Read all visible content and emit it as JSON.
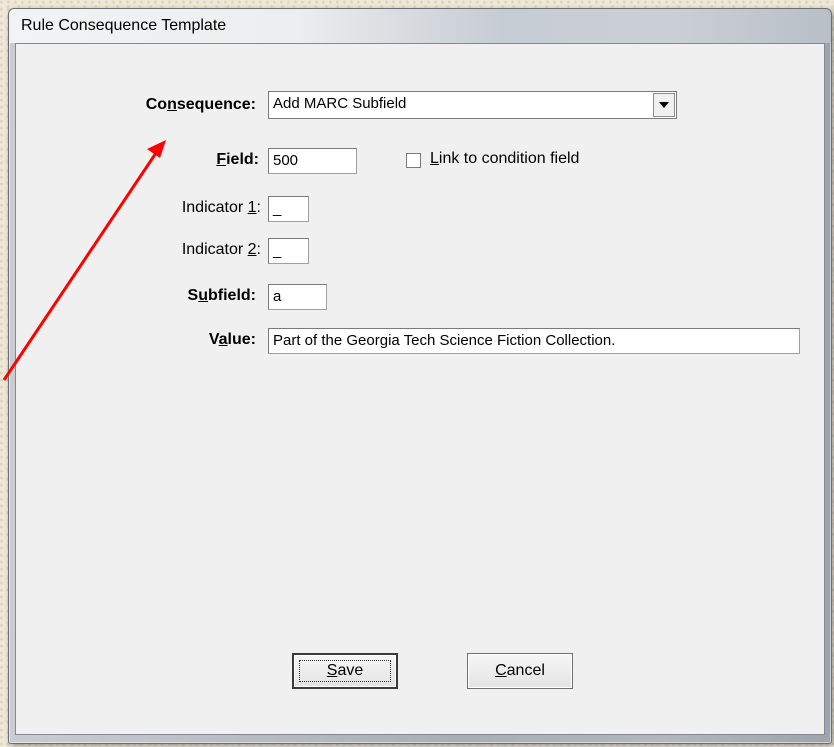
{
  "window": {
    "title": "Rule Consequence Template"
  },
  "form": {
    "consequence": {
      "label_pre": "Co",
      "label_key": "n",
      "label_post": "sequence:",
      "value": "Add MARC Subfield"
    },
    "field": {
      "label_key": "F",
      "label_post": "ield:",
      "value": "500"
    },
    "link_checkbox": {
      "label_key": "L",
      "label_post": "ink to condition field",
      "checked": false
    },
    "indicator1": {
      "label_pre": "Indicator ",
      "label_key": "1",
      "label_post": ":",
      "value": "_"
    },
    "indicator2": {
      "label_pre": "Indicator ",
      "label_key": "2",
      "label_post": ":",
      "value": "_"
    },
    "subfield": {
      "label_pre": "S",
      "label_key": "u",
      "label_post": "bfield:",
      "value": "a"
    },
    "value": {
      "label_pre": "V",
      "label_key": "a",
      "label_post": "lue:",
      "value": "Part of the Georgia Tech Science Fiction Collection."
    }
  },
  "buttons": {
    "save": {
      "label_key": "S",
      "label_post": "ave"
    },
    "cancel": {
      "label_key": "C",
      "label_post": "ancel"
    }
  },
  "annotation": {
    "arrow_color": "#ff0000",
    "arrow_target": "field-label"
  }
}
